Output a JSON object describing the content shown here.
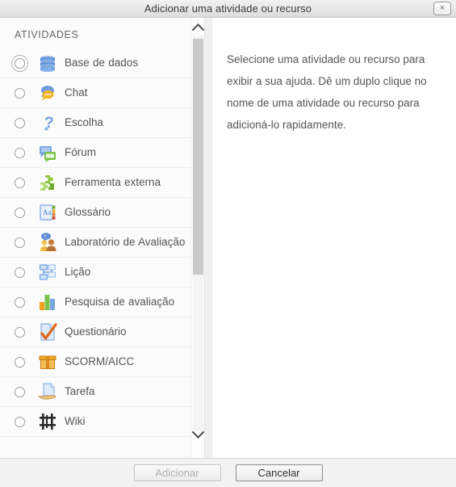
{
  "window": {
    "title": "Adicionar uma atividade ou recurso",
    "close_label": "×"
  },
  "sidebar": {
    "heading": "ATIVIDADES",
    "items": [
      {
        "label": "Base de dados",
        "icon": "database-icon",
        "selected": false,
        "focused": true
      },
      {
        "label": "Chat",
        "icon": "chat-bubbles-icon",
        "selected": false,
        "focused": false
      },
      {
        "label": "Escolha",
        "icon": "question-mark-icon",
        "selected": false,
        "focused": false
      },
      {
        "label": "Fórum",
        "icon": "forum-bubbles-icon",
        "selected": false,
        "focused": false
      },
      {
        "label": "Ferramenta externa",
        "icon": "puzzle-piece-icon",
        "selected": false,
        "focused": false
      },
      {
        "label": "Glossário",
        "icon": "glossary-book-icon",
        "selected": false,
        "focused": false
      },
      {
        "label": "Laboratório de Avaliação",
        "icon": "workshop-people-icon",
        "selected": false,
        "focused": false
      },
      {
        "label": "Lição",
        "icon": "lesson-flowchart-icon",
        "selected": false,
        "focused": false
      },
      {
        "label": "Pesquisa de avaliação",
        "icon": "bar-chart-icon",
        "selected": false,
        "focused": false
      },
      {
        "label": "Questionário",
        "icon": "quiz-checkmark-icon",
        "selected": false,
        "focused": false
      },
      {
        "label": "SCORM/AICC",
        "icon": "scorm-package-icon",
        "selected": false,
        "focused": false
      },
      {
        "label": "Tarefa",
        "icon": "assignment-hand-icon",
        "selected": false,
        "focused": false
      },
      {
        "label": "Wiki",
        "icon": "wiki-grid-icon",
        "selected": false,
        "focused": false
      }
    ]
  },
  "help": {
    "text": "Selecione uma atividade ou recurso para exibir a sua ajuda. Dê um duplo clique no nome de uma atividade ou recurso para adicioná-lo rapidamente."
  },
  "footer": {
    "add_label": "Adicionar",
    "cancel_label": "Cancelar"
  },
  "colors": {
    "titlebar": "#e6e6e6",
    "footer": "#f2f2f2",
    "text": "#555555",
    "scrollbar_thumb": "#c9c9c9"
  }
}
